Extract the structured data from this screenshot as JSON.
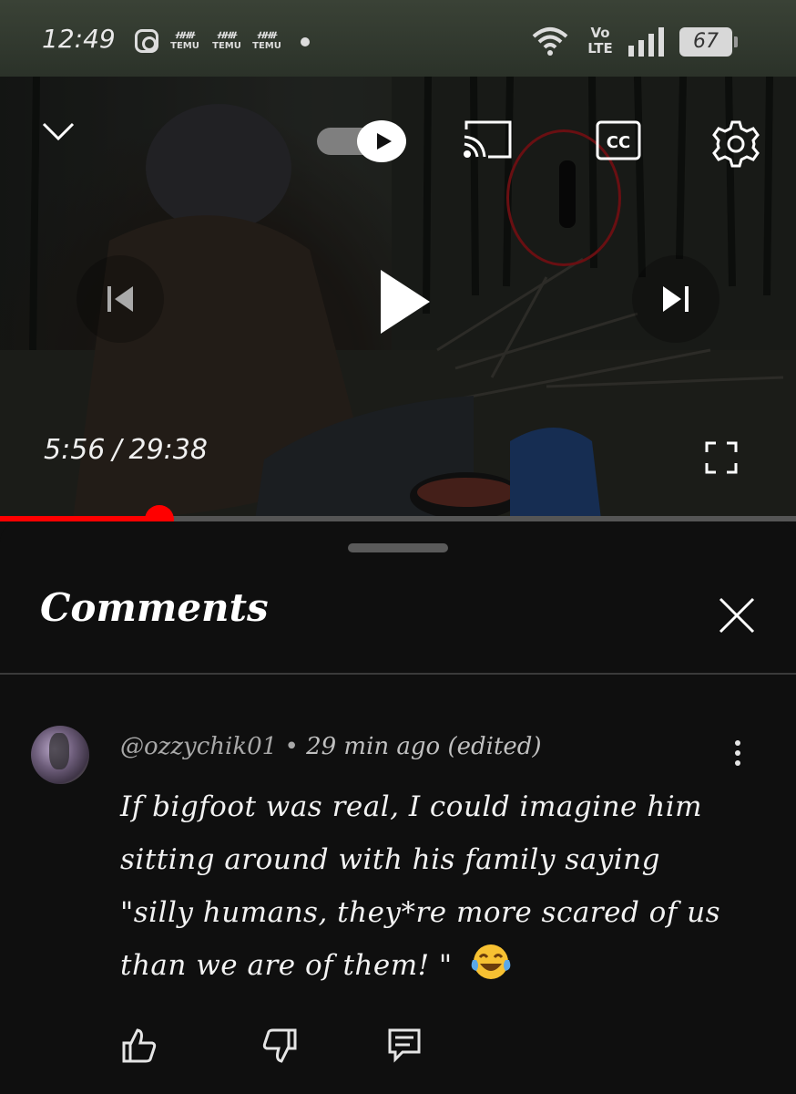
{
  "status_bar": {
    "time": "12:49",
    "notification_icons": [
      "instagram-icon",
      "temu-icon",
      "temu-icon",
      "temu-icon"
    ],
    "temu_label": "TEMU",
    "network_label_top": "Vo",
    "network_label_bottom": "LTE",
    "battery_level": "67"
  },
  "player": {
    "current_time": "5:56",
    "separator": "/",
    "duration": "29:38",
    "progress_fraction": 0.2,
    "captions_label": "CC",
    "autoplay_on": true,
    "accent_color": "#ff0000"
  },
  "comments": {
    "title": "Comments",
    "items": [
      {
        "author": "@ozzychik01",
        "time_ago": "29 min ago (edited)",
        "text": "If bigfoot was real, I could imagine him sitting around with his family saying \"silly humans, they*re more scared of us than we are of them! \"",
        "emoji": "face-with-tears-of-joy"
      }
    ]
  }
}
